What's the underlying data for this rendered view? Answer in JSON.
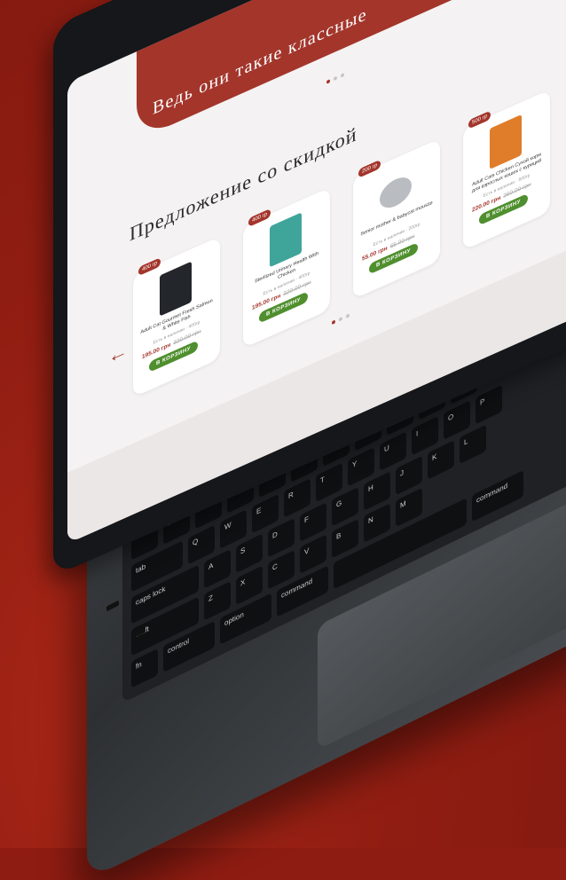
{
  "hero": {
    "title": "Ведь они такие классные"
  },
  "section": {
    "title": "Предложение со скидкой"
  },
  "products": [
    {
      "badge": "400 гр",
      "name": "Adult Cat Gourmet Fresh Salmon & White Fish",
      "stock": "Есть в наличии · 400гр",
      "price": "195.00 грн",
      "old_price": "320.00 грн",
      "button": "В КОРЗИНУ",
      "color": "#23272b"
    },
    {
      "badge": "400 гр",
      "name": "Sterilized Urinary Health With Chicken",
      "stock": "Есть в наличии · 400гр",
      "price": "195.00 грн",
      "old_price": "320.00 грн",
      "button": "В КОРЗИНУ",
      "color": "#3fa59a"
    },
    {
      "badge": "200 гр",
      "name": "Senior mother & babycat mousse",
      "stock": "Есть в наличии · 200гр",
      "price": "55.00 грн",
      "old_price": "65.00 грн",
      "button": "В КОРЗИНУ",
      "color": "#b9bcc0"
    },
    {
      "badge": "500 гр",
      "name": "Adult Cats Chicken Сухой корм для взрослых кошек с курицей",
      "stock": "Есть в наличии · 500гр",
      "price": "220.00 грн",
      "old_price": "260.00 грн",
      "button": "В КОРЗИНУ",
      "color": "#e07d2a"
    }
  ],
  "keyboard": {
    "rows": [
      [
        "esc",
        "",
        "",
        "",
        "",
        "",
        "",
        "",
        "",
        "",
        "",
        ""
      ],
      [
        "~",
        "1",
        "2",
        "3",
        "4",
        "5",
        "6",
        "7",
        "8",
        "9",
        "0"
      ],
      [
        "tab",
        "Q",
        "W",
        "E",
        "R",
        "T",
        "Y",
        "U",
        "I",
        "O",
        "P"
      ],
      [
        "caps lock",
        "A",
        "S",
        "D",
        "F",
        "G",
        "H",
        "J",
        "K",
        "L"
      ],
      [
        "shift",
        "Z",
        "X",
        "C",
        "V",
        "B",
        "N",
        "M"
      ],
      [
        "fn",
        "control",
        "option",
        "command",
        "",
        "command"
      ]
    ]
  },
  "colors": {
    "accent": "#a3352b",
    "button": "#4f8f2e",
    "background": "#8f1c12"
  }
}
